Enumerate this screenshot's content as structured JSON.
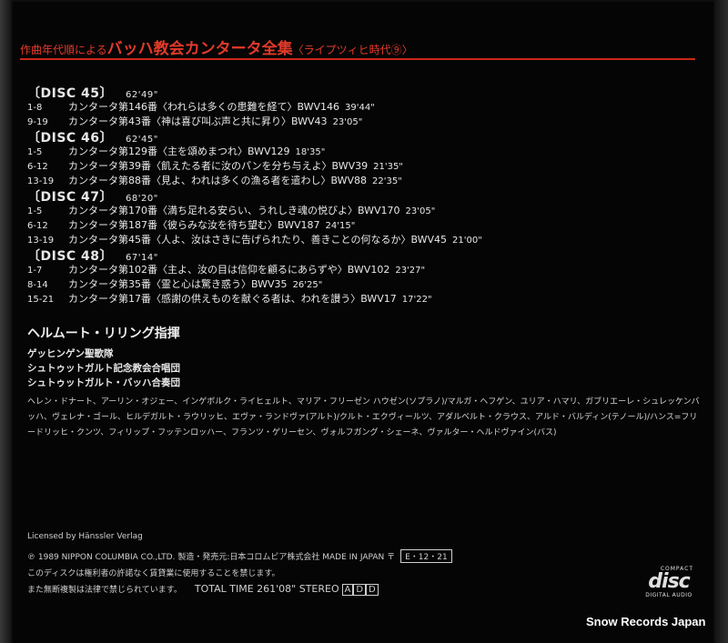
{
  "title": {
    "prefix": "作曲年代順による",
    "main": "バッハ教会カンタータ全集",
    "suffix": "〈ライプツィヒ時代⑨〉"
  },
  "discs": [
    {
      "label": "〔DISC 45〕",
      "time": "62'49\"",
      "tracks": [
        {
          "nums": "1-8",
          "title": "カンタータ第146番〈われらは多くの患難を経て〉BWV146",
          "dur": "39'44\""
        },
        {
          "nums": "9-19",
          "title": "カンタータ第43番〈神は喜び叫ぶ声と共に昇り〉BWV43",
          "dur": "23'05\""
        }
      ]
    },
    {
      "label": "〔DISC 46〕",
      "time": "62'45\"",
      "tracks": [
        {
          "nums": "1-5",
          "title": "カンタータ第129番〈主を頌めまつれ〉BWV129",
          "dur": "18'35\""
        },
        {
          "nums": "6-12",
          "title": "カンタータ第39番〈飢えたる者に汝のパンを分ち与えよ〉BWV39",
          "dur": "21'35\""
        },
        {
          "nums": "13-19",
          "title": "カンタータ第88番〈見よ、われは多くの漁る者を遣わし〉BWV88",
          "dur": "22'35\""
        }
      ]
    },
    {
      "label": "〔DISC 47〕",
      "time": "68'20\"",
      "tracks": [
        {
          "nums": "1-5",
          "title": "カンタータ第170番〈満ち足れる安らい、うれしき魂の悦びよ〉BWV170",
          "dur": "23'05\""
        },
        {
          "nums": "6-12",
          "title": "カンタータ第187番〈彼らみな汝を待ち望む〉BWV187",
          "dur": "24'15\""
        },
        {
          "nums": "13-19",
          "title": "カンタータ第45番〈人よ、汝はさきに告げられたり、善きことの何なるか〉BWV45",
          "dur": "21'00\""
        }
      ]
    },
    {
      "label": "〔DISC 48〕",
      "time": "67'14\"",
      "tracks": [
        {
          "nums": "1-7",
          "title": "カンタータ第102番〈主よ、汝の目は信仰を顧るにあらずや〉BWV102",
          "dur": "23'27\""
        },
        {
          "nums": "8-14",
          "title": "カンタータ第35番〈霊と心は驚き惑う〉BWV35",
          "dur": "26'25\""
        },
        {
          "nums": "15-21",
          "title": "カンタータ第17番〈感謝の供えものを献ぐる者は、われを讃う〉BWV17",
          "dur": "17'22\""
        }
      ]
    }
  ],
  "conductor": "ヘルムート・リリング指揮",
  "ensembles": [
    "ゲッヒンゲン聖歌隊",
    "シュトゥットガルト記念教会合唱団",
    "シュトゥットガルト・バッハ合奏団"
  ],
  "soloists": "ヘレン・ドナート、アーリン・オジェー、インゲボルク・ライヒェルト、マリア・フリーゼン ハウゼン(ソプラノ)/マルガ・ヘフゲン、ユリア・ハマリ、ガブリエーレ・シュレッケンバッハ、ヴェレナ・ゴール、ヒルデガルト・ラウリッヒ、エヴァ・ランドヴァ(アルト)/クルト・エクヴィールツ、アダルベルト・クラウス、アルド・バルディン(テノール)/ハンス=フリードリッヒ・クンツ、フィリップ・フッテンロッハー、フランツ・ゲリーセン、ヴォルフガング・シェーネ、ヴァルター・ヘルドヴァイン(バス)",
  "licensed": "Licensed by Hänssler Verlag",
  "copyright": "℗ 1989 NIPPON COLUMBIA CO.,LTD. 製造・発売元:日本コロムビア株式会社 MADE IN JAPAN 〒",
  "catalog": "E・12・21",
  "notice": "このディスクは権利者の許諾なく賃貸業に使用することを禁じます。",
  "bottom_notice": "また無断複製は法律で禁じられています。",
  "total_time": "TOTAL TIME 261'08\"  STEREO",
  "add_codes": [
    "A",
    "D",
    "D"
  ],
  "cd_logo": {
    "top": "COMPACT",
    "main": "disc",
    "bottom": "DIGITAL AUDIO"
  },
  "watermark": "Snow Records Japan",
  "colors": {
    "title_red": "#e33a2a",
    "rule_red": "#c8281c",
    "background": "#050505"
  }
}
